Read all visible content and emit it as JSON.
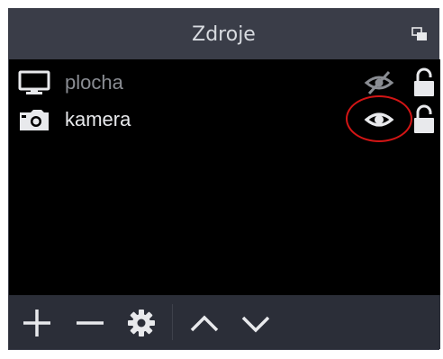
{
  "dock": {
    "title": "Zdroje",
    "float_icon": "undock-icon"
  },
  "sources": [
    {
      "name": "plocha",
      "type_icon": "monitor-icon",
      "visible": false,
      "visibility_icon": "eye-slash-icon",
      "lock_icon": "lock-open-icon"
    },
    {
      "name": "kamera",
      "type_icon": "camera-icon",
      "visible": true,
      "visibility_icon": "eye-icon",
      "lock_icon": "lock-open-icon"
    }
  ],
  "toolbar": {
    "buttons": [
      "plus-icon",
      "minus-icon",
      "gear-icon",
      "chevron-up-icon",
      "chevron-down-icon"
    ]
  },
  "colors": {
    "panel_bg": "#2b2e38",
    "title_bg": "#3a3d48",
    "list_bg": "#000000",
    "icon_light": "#e8e9ec",
    "icon_dim": "#8a8d93",
    "highlight": "#d31515"
  }
}
